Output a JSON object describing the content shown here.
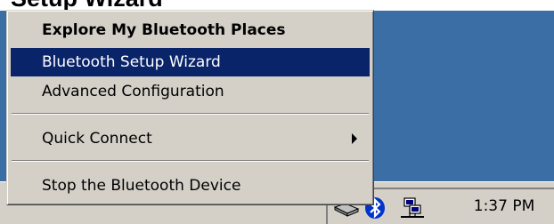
{
  "heading": {
    "text": "Setup Wizard"
  },
  "menu": {
    "items": [
      {
        "label": "Explore My Bluetooth Places",
        "bold": true
      },
      {
        "label": "Bluetooth Setup Wizard",
        "selected": true
      },
      {
        "label": "Advanced Configuration"
      },
      {
        "label": "Quick Connect",
        "submenu": true
      },
      {
        "label": "Stop the Bluetooth Device"
      }
    ]
  },
  "taskbar": {
    "tray": {
      "icons": [
        "network-drive-icon",
        "bluetooth-icon",
        "network-computers-icon"
      ],
      "clock": "1:37 PM"
    }
  },
  "colors": {
    "desktop": "#3a6ea5",
    "menu_bg": "#d4d0c8",
    "highlight": "#0a246a"
  }
}
